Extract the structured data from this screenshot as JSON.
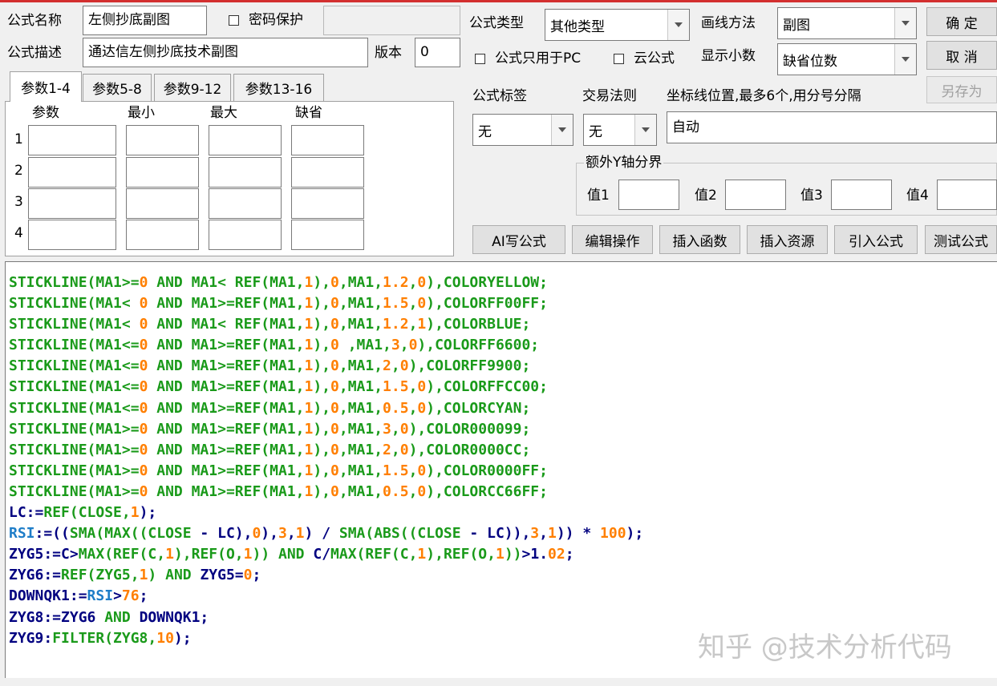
{
  "colors": {
    "keyword_green": "#1a9a1a",
    "number_orange": "#ff7f00",
    "dark_text": "#000080",
    "blue_text": "#1e7dc8",
    "accent_bar": "#d32f2f"
  },
  "header": {
    "name_label": "公式名称",
    "name_value": "左侧抄底副图",
    "password_label": "密码保护",
    "password_value": "",
    "desc_label": "公式描述",
    "desc_value": "通达信左侧抄底技术副图",
    "version_label": "版本",
    "version_value": "0"
  },
  "right_panel": {
    "type_label": "公式类型",
    "type_value": "其他类型",
    "draw_label": "画线方法",
    "draw_value": "副图",
    "pc_only_label": "公式只用于PC",
    "cloud_label": "云公式",
    "decimals_label": "显示小数",
    "decimals_value": "缺省位数",
    "ok_button": "确 定",
    "cancel_button": "取 消",
    "save_as_button": "另存为",
    "tag_label": "公式标签",
    "tag_value": "无",
    "trade_label": "交易法则",
    "trade_value": "无",
    "axis_label": "坐标线位置,最多6个,用分号分隔",
    "axis_value": "自动",
    "extra_y_title": "额外Y轴分界",
    "y_labels": [
      "值1",
      "值2",
      "值3",
      "值4"
    ],
    "buttons": [
      "AI写公式",
      "编辑操作",
      "插入函数",
      "插入资源",
      "引入公式",
      "测试公式"
    ]
  },
  "tabs": [
    "参数1-4",
    "参数5-8",
    "参数9-12",
    "参数13-16"
  ],
  "param_table": {
    "headers": [
      "参数",
      "最小",
      "最大",
      "缺省"
    ],
    "rows": [
      "1",
      "2",
      "3",
      "4"
    ]
  },
  "code_lines": [
    [
      [
        "STICKLINE(MA1>=",
        "g"
      ],
      [
        "0",
        "o"
      ],
      [
        " AND MA1< REF(MA1,",
        "g"
      ],
      [
        "1",
        "o"
      ],
      [
        "),",
        "g"
      ],
      [
        "0",
        "o"
      ],
      [
        ",MA1,",
        "g"
      ],
      [
        "1.2",
        "o"
      ],
      [
        ",",
        "g"
      ],
      [
        "0",
        "o"
      ],
      [
        "),COLORYELLOW;",
        "g"
      ]
    ],
    [
      [
        "STICKLINE(MA1< ",
        "g"
      ],
      [
        "0",
        "o"
      ],
      [
        " AND MA1>=REF(MA1,",
        "g"
      ],
      [
        "1",
        "o"
      ],
      [
        "),",
        "g"
      ],
      [
        "0",
        "o"
      ],
      [
        ",MA1,",
        "g"
      ],
      [
        "1.5",
        "o"
      ],
      [
        ",",
        "g"
      ],
      [
        "0",
        "o"
      ],
      [
        "),COLORFF00FF;",
        "g"
      ]
    ],
    [
      [
        "STICKLINE(MA1< ",
        "g"
      ],
      [
        "0",
        "o"
      ],
      [
        " AND MA1< REF(MA1,",
        "g"
      ],
      [
        "1",
        "o"
      ],
      [
        "),",
        "g"
      ],
      [
        "0",
        "o"
      ],
      [
        ",MA1,",
        "g"
      ],
      [
        "1.2",
        "o"
      ],
      [
        ",",
        "g"
      ],
      [
        "1",
        "o"
      ],
      [
        "),COLORBLUE;",
        "g"
      ]
    ],
    [
      [
        "STICKLINE(MA1<=",
        "g"
      ],
      [
        "0",
        "o"
      ],
      [
        " AND MA1>=REF(MA1,",
        "g"
      ],
      [
        "1",
        "o"
      ],
      [
        "),",
        "g"
      ],
      [
        "0",
        "o"
      ],
      [
        " ,MA1,",
        "g"
      ],
      [
        "3",
        "o"
      ],
      [
        ",",
        "g"
      ],
      [
        "0",
        "o"
      ],
      [
        "),COLORFF6600;",
        "g"
      ]
    ],
    [
      [
        "STICKLINE(MA1<=",
        "g"
      ],
      [
        "0",
        "o"
      ],
      [
        " AND MA1>=REF(MA1,",
        "g"
      ],
      [
        "1",
        "o"
      ],
      [
        "),",
        "g"
      ],
      [
        "0",
        "o"
      ],
      [
        ",MA1,",
        "g"
      ],
      [
        "2",
        "o"
      ],
      [
        ",",
        "g"
      ],
      [
        "0",
        "o"
      ],
      [
        "),COLORFF9900;",
        "g"
      ]
    ],
    [
      [
        "STICKLINE(MA1<=",
        "g"
      ],
      [
        "0",
        "o"
      ],
      [
        " AND MA1>=REF(MA1,",
        "g"
      ],
      [
        "1",
        "o"
      ],
      [
        "),",
        "g"
      ],
      [
        "0",
        "o"
      ],
      [
        ",MA1,",
        "g"
      ],
      [
        "1.5",
        "o"
      ],
      [
        ",",
        "g"
      ],
      [
        "0",
        "o"
      ],
      [
        "),COLORFFCC00;",
        "g"
      ]
    ],
    [
      [
        "STICKLINE(MA1<=",
        "g"
      ],
      [
        "0",
        "o"
      ],
      [
        " AND MA1>=REF(MA1,",
        "g"
      ],
      [
        "1",
        "o"
      ],
      [
        "),",
        "g"
      ],
      [
        "0",
        "o"
      ],
      [
        ",MA1,",
        "g"
      ],
      [
        "0.5",
        "o"
      ],
      [
        ",",
        "g"
      ],
      [
        "0",
        "o"
      ],
      [
        "),COLORCYAN;",
        "g"
      ]
    ],
    [
      [
        "STICKLINE(MA1>=",
        "g"
      ],
      [
        "0",
        "o"
      ],
      [
        " AND MA1>=REF(MA1,",
        "g"
      ],
      [
        "1",
        "o"
      ],
      [
        "),",
        "g"
      ],
      [
        "0",
        "o"
      ],
      [
        ",MA1,",
        "g"
      ],
      [
        "3",
        "o"
      ],
      [
        ",",
        "g"
      ],
      [
        "0",
        "o"
      ],
      [
        "),COLOR000099;",
        "g"
      ]
    ],
    [
      [
        "STICKLINE(MA1>=",
        "g"
      ],
      [
        "0",
        "o"
      ],
      [
        " AND MA1>=REF(MA1,",
        "g"
      ],
      [
        "1",
        "o"
      ],
      [
        "),",
        "g"
      ],
      [
        "0",
        "o"
      ],
      [
        ",MA1,",
        "g"
      ],
      [
        "2",
        "o"
      ],
      [
        ",",
        "g"
      ],
      [
        "0",
        "o"
      ],
      [
        "),COLOR0000CC;",
        "g"
      ]
    ],
    [
      [
        "STICKLINE(MA1>=",
        "g"
      ],
      [
        "0",
        "o"
      ],
      [
        " AND MA1>=REF(MA1,",
        "g"
      ],
      [
        "1",
        "o"
      ],
      [
        "),",
        "g"
      ],
      [
        "0",
        "o"
      ],
      [
        ",MA1,",
        "g"
      ],
      [
        "1.5",
        "o"
      ],
      [
        ",",
        "g"
      ],
      [
        "0",
        "o"
      ],
      [
        "),COLOR0000FF;",
        "g"
      ]
    ],
    [
      [
        "STICKLINE(MA1>=",
        "g"
      ],
      [
        "0",
        "o"
      ],
      [
        " AND MA1>=REF(MA1,",
        "g"
      ],
      [
        "1",
        "o"
      ],
      [
        "),",
        "g"
      ],
      [
        "0",
        "o"
      ],
      [
        ",MA1,",
        "g"
      ],
      [
        "0.5",
        "o"
      ],
      [
        ",",
        "g"
      ],
      [
        "0",
        "o"
      ],
      [
        "),COLORCC66FF;",
        "g"
      ]
    ],
    [
      [
        "LC:=",
        "k"
      ],
      [
        "REF(CLOSE,",
        "g"
      ],
      [
        "1",
        "o"
      ],
      [
        ");",
        "k"
      ]
    ],
    [
      [
        "RSI",
        "b"
      ],
      [
        ":=((",
        "k"
      ],
      [
        "SMA(MAX((CLOSE",
        "g"
      ],
      [
        " - LC),",
        "k"
      ],
      [
        "0",
        "o"
      ],
      [
        "),",
        "k"
      ],
      [
        "3",
        "o"
      ],
      [
        ",",
        "k"
      ],
      [
        "1",
        "o"
      ],
      [
        ") / ",
        "k"
      ],
      [
        "SMA(ABS((CLOSE",
        "g"
      ],
      [
        " - LC)),",
        "k"
      ],
      [
        "3",
        "o"
      ],
      [
        ",",
        "k"
      ],
      [
        "1",
        "o"
      ],
      [
        "))",
        "k"
      ],
      [
        " * ",
        "k"
      ],
      [
        "100",
        "o"
      ],
      [
        ");",
        "k"
      ]
    ],
    [
      [
        "ZYG5:=C>",
        "k"
      ],
      [
        "MAX(REF(C,",
        "g"
      ],
      [
        "1",
        "o"
      ],
      [
        "),",
        "g"
      ],
      [
        "REF(O,",
        "g"
      ],
      [
        "1",
        "o"
      ],
      [
        "))",
        "g"
      ],
      [
        " AND ",
        "g"
      ],
      [
        "C/",
        "k"
      ],
      [
        "MAX(REF(C,",
        "g"
      ],
      [
        "1",
        "o"
      ],
      [
        "),",
        "g"
      ],
      [
        "REF(O,",
        "g"
      ],
      [
        "1",
        "o"
      ],
      [
        "))",
        "g"
      ],
      [
        ">1.",
        "k"
      ],
      [
        "02",
        "o"
      ],
      [
        ";",
        "k"
      ]
    ],
    [
      [
        "ZYG6:=",
        "k"
      ],
      [
        "REF(ZYG5,",
        "g"
      ],
      [
        "1",
        "o"
      ],
      [
        ")",
        "g"
      ],
      [
        " AND ",
        "g"
      ],
      [
        "ZYG5=",
        "k"
      ],
      [
        "0",
        "o"
      ],
      [
        ";",
        "k"
      ]
    ],
    [
      [
        "DOWNQK1:=",
        "k"
      ],
      [
        "RSI",
        "b"
      ],
      [
        ">",
        "k"
      ],
      [
        "76",
        "o"
      ],
      [
        ";",
        "k"
      ]
    ],
    [
      [
        "ZYG8:=ZYG6 ",
        "k"
      ],
      [
        "AND",
        "g"
      ],
      [
        " DOWNQK1;",
        "k"
      ]
    ],
    [
      [
        "ZYG9:",
        "k"
      ],
      [
        "FILTER(ZYG8,",
        "g"
      ],
      [
        "10",
        "o"
      ],
      [
        ");",
        "k"
      ]
    ]
  ],
  "watermark": "知乎 @技术分析代码"
}
